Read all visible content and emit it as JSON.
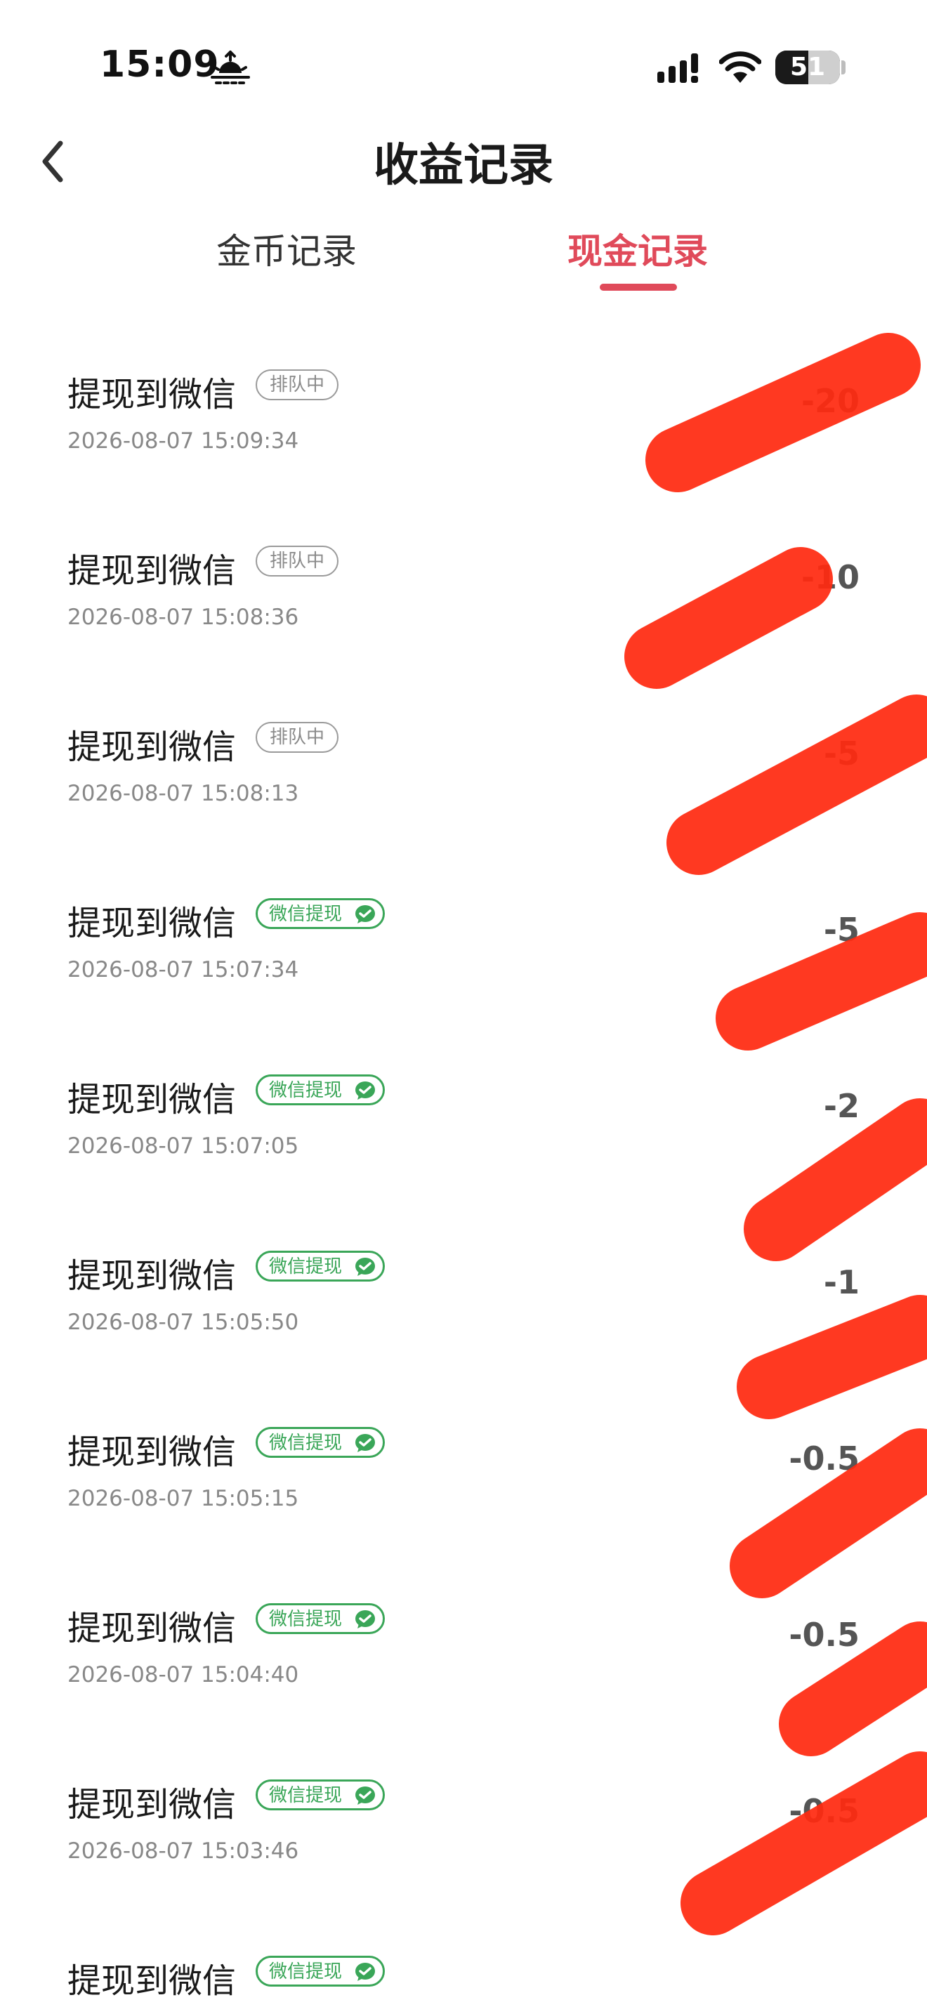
{
  "status_bar": {
    "time": "15:09",
    "battery_level": "51",
    "battery_percent": 51
  },
  "header": {
    "title": "收益记录"
  },
  "tabs": [
    {
      "label": "金币记录",
      "active": false
    },
    {
      "label": "现金记录",
      "active": true
    }
  ],
  "colors": {
    "accent": "#e04a5a",
    "wechat_green": "#3aa658",
    "marker_red": "#ff2a10"
  },
  "records": [
    {
      "title": "提现到微信",
      "badge": "排队中",
      "badge_type": "queued",
      "time": "2026-08-07 15:09:34",
      "amount": "-20"
    },
    {
      "title": "提现到微信",
      "badge": "排队中",
      "badge_type": "queued",
      "time": "2026-08-07 15:08:36",
      "amount": "-10"
    },
    {
      "title": "提现到微信",
      "badge": "排队中",
      "badge_type": "queued",
      "time": "2026-08-07 15:08:13",
      "amount": "-5"
    },
    {
      "title": "提现到微信",
      "badge": "微信提现",
      "badge_type": "wechat",
      "time": "2026-08-07 15:07:34",
      "amount": "-5"
    },
    {
      "title": "提现到微信",
      "badge": "微信提现",
      "badge_type": "wechat",
      "time": "2026-08-07 15:07:05",
      "amount": "-2"
    },
    {
      "title": "提现到微信",
      "badge": "微信提现",
      "badge_type": "wechat",
      "time": "2026-08-07 15:05:50",
      "amount": "-1"
    },
    {
      "title": "提现到微信",
      "badge": "微信提现",
      "badge_type": "wechat",
      "time": "2026-08-07 15:05:15",
      "amount": "-0.5"
    },
    {
      "title": "提现到微信",
      "badge": "微信提现",
      "badge_type": "wechat",
      "time": "2026-08-07 15:04:40",
      "amount": "-0.5"
    },
    {
      "title": "提现到微信",
      "badge": "微信提现",
      "badge_type": "wechat",
      "time": "2026-08-07 15:03:46",
      "amount": "-0.5"
    },
    {
      "title": "提现到微信",
      "badge": "微信提现",
      "badge_type": "wechat",
      "time": "",
      "amount": ""
    }
  ]
}
